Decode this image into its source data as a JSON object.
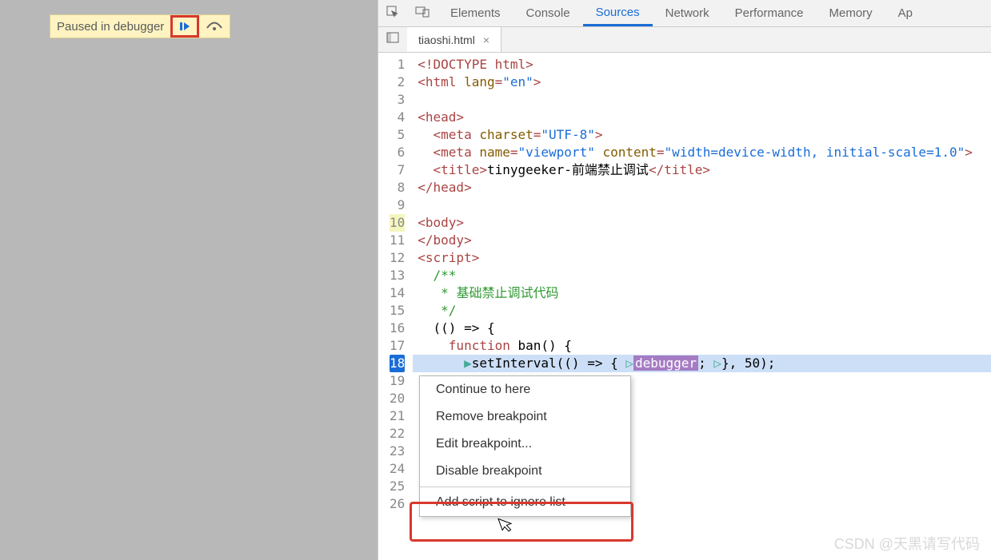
{
  "pausedOverlay": {
    "label": "Paused in debugger",
    "resumeIcon": "resume-icon",
    "stepIcon": "step-over-icon"
  },
  "devtools": {
    "tabs": [
      "Elements",
      "Console",
      "Sources",
      "Network",
      "Performance",
      "Memory",
      "Ap"
    ],
    "activeTab": "Sources",
    "file": {
      "name": "tiaoshi.html"
    }
  },
  "code": {
    "lines": [
      {
        "n": 1,
        "html": "<span class='tok-tag'>&lt;!DOCTYPE html&gt;</span>"
      },
      {
        "n": 2,
        "html": "<span class='tok-tag'>&lt;html <span class='tok-attr'>lang</span>=<span class='tok-str'>\"en\"</span>&gt;</span>"
      },
      {
        "n": 3,
        "html": ""
      },
      {
        "n": 4,
        "html": "<span class='tok-tag'>&lt;head&gt;</span>"
      },
      {
        "n": 5,
        "html": "  <span class='tok-tag'>&lt;meta <span class='tok-attr'>charset</span>=<span class='tok-str'>\"UTF-8\"</span>&gt;</span>"
      },
      {
        "n": 6,
        "html": "  <span class='tok-tag'>&lt;meta <span class='tok-attr'>name</span>=<span class='tok-str'>\"viewport\"</span> <span class='tok-attr'>content</span>=<span class='tok-str'>\"width=device-width, initial-scale=1.0\"</span>&gt;</span>"
      },
      {
        "n": 7,
        "html": "  <span class='tok-tag'>&lt;title&gt;</span>tinygeeker-前端禁止调试<span class='tok-tag'>&lt;/title&gt;</span>"
      },
      {
        "n": 8,
        "html": "<span class='tok-tag'>&lt;/head&gt;</span>"
      },
      {
        "n": 9,
        "html": ""
      },
      {
        "n": 10,
        "html": "<span class='tok-tag'>&lt;body&gt;</span>",
        "exec": true
      },
      {
        "n": 11,
        "html": "<span class='tok-tag'>&lt;/body&gt;</span>"
      },
      {
        "n": 12,
        "html": "<span class='tok-tag'>&lt;script&gt;</span>"
      },
      {
        "n": 13,
        "html": "  <span class='tok-comm'>/**</span>"
      },
      {
        "n": 14,
        "html": "   <span class='tok-comm'>* 基础禁止调试代码</span>"
      },
      {
        "n": 15,
        "html": "   <span class='tok-comm'>*/</span>"
      },
      {
        "n": 16,
        "html": "  (() =&gt; {"
      },
      {
        "n": 17,
        "html": "    <span class='tok-kw'>function</span> ban() {"
      },
      {
        "n": 18,
        "html": "      <span class='tok-mark'>▶</span>setInterval(() =&gt; { <span class='tok-mark'>▷</span><span class='tok-dbg'>debugger</span>; <span class='tok-mark'>▷</span>}, 50);",
        "bp": true,
        "hl": true
      },
      {
        "n": 19,
        "html": ""
      },
      {
        "n": 20,
        "html": ""
      },
      {
        "n": 21,
        "html": ""
      },
      {
        "n": 22,
        "html": ""
      },
      {
        "n": 23,
        "html": ""
      },
      {
        "n": 24,
        "html": ""
      },
      {
        "n": 25,
        "html": ""
      },
      {
        "n": 26,
        "html": ""
      }
    ]
  },
  "contextMenu": {
    "items": [
      "Continue to here",
      "Remove breakpoint",
      "Edit breakpoint...",
      "Disable breakpoint"
    ],
    "separatorAfter": 3,
    "finalItem": "Add script to ignore list"
  },
  "watermark": "CSDN @天黑请写代码"
}
